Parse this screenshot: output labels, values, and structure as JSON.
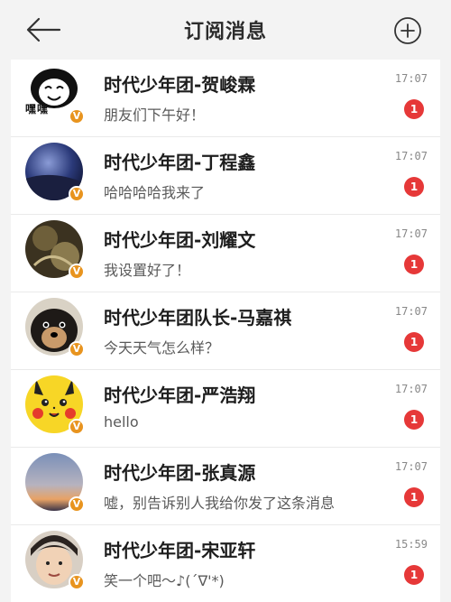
{
  "header": {
    "title": "订阅消息"
  },
  "messages": [
    {
      "name": "时代少年团-贺峻霖",
      "preview": "朋友们下午好！",
      "time": "17:07",
      "unread": "1",
      "avatar_caption": "嘿嘿"
    },
    {
      "name": "时代少年团-丁程鑫",
      "preview": "哈哈哈哈我来了",
      "time": "17:07",
      "unread": "1"
    },
    {
      "name": "时代少年团-刘耀文",
      "preview": "我设置好了！",
      "time": "17:07",
      "unread": "1"
    },
    {
      "name": "时代少年团队长-马嘉祺",
      "preview": "今天天气怎么样？",
      "time": "17:07",
      "unread": "1"
    },
    {
      "name": "时代少年团-严浩翔",
      "preview": "hello",
      "time": "17:07",
      "unread": "1"
    },
    {
      "name": "时代少年团-张真源",
      "preview": "嘘，别告诉别人我给你发了这条消息",
      "time": "17:07",
      "unread": "1"
    },
    {
      "name": "时代少年团-宋亚轩",
      "preview": "笑一个吧～♪(´∇'*)",
      "time": "15:59",
      "unread": "1"
    }
  ],
  "verified_badge": "V",
  "colors": {
    "unread_badge": "#e63838",
    "verified_badge": "#e8941f",
    "background": "#f3f3f3"
  }
}
